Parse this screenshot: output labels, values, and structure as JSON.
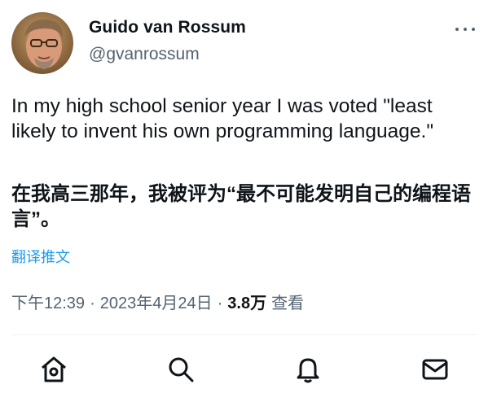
{
  "author": {
    "name": "Guido van Rossum",
    "handle": "@gvanrossum"
  },
  "tweet": {
    "text_en": "In my high school senior year I was voted \"least likely to invent his own programming language.\"",
    "text_zh": "在我高三那年，我被评为“最不可能发明自己的编程语言”。",
    "translate_label": "翻译推文"
  },
  "meta": {
    "time": "下午12:39",
    "separator": "·",
    "date": "2023年4月24日",
    "views_count": "3.8万",
    "views_label": "查看"
  },
  "nav": {
    "icons": [
      "home-icon",
      "search-icon",
      "notifications-icon",
      "messages-icon"
    ]
  },
  "colors": {
    "text": "#0f1419",
    "secondary": "#536471",
    "link": "#1d9bf0",
    "divider": "#eff3f4"
  }
}
